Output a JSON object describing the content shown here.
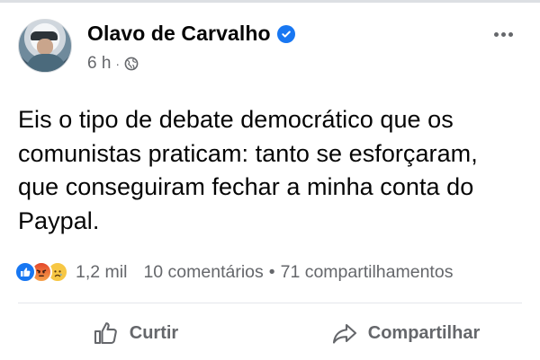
{
  "post": {
    "author": "Olavo de Carvalho",
    "verified": true,
    "time": "6 h",
    "separator": "·",
    "audience_icon": "globe-icon",
    "text": "Eis o tipo de debate democrático que os comunistas praticam: tanto se esforçaram, que conseguiram fechar a minha conta do Paypal."
  },
  "stats": {
    "reactions": [
      "like",
      "angry",
      "sad"
    ],
    "reaction_count": "1,2 mil",
    "comments": "10 comentários",
    "bullet": "•",
    "shares": "71 compartilhamentos"
  },
  "actions": {
    "like_label": "Curtir",
    "share_label": "Compartilhar"
  },
  "colors": {
    "brand": "#1877f2",
    "secondary_text": "#65676b",
    "primary_text": "#050505"
  }
}
